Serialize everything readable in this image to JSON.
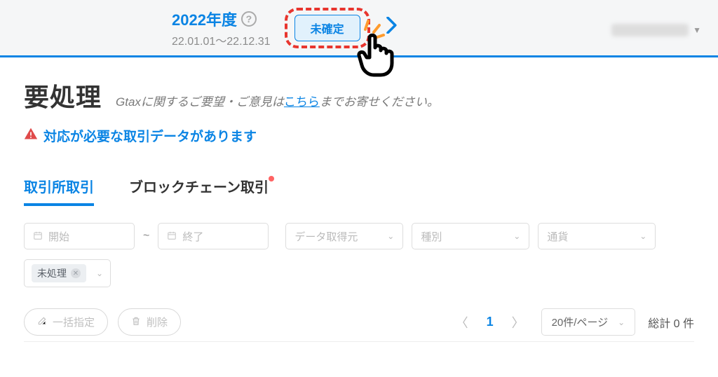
{
  "header": {
    "year_title": "2022年度",
    "date_range": "22.01.01～22.12.31",
    "status_btn": "未確定"
  },
  "page": {
    "title": "要処理",
    "subtitle_prefix": "Gtaxに関するご要望・ご意見は",
    "subtitle_link": "こちら",
    "subtitle_suffix": "までお寄せください。",
    "warning": "対応が必要な取引データがあります"
  },
  "tabs": [
    {
      "label": "取引所取引",
      "active": true,
      "dot": false
    },
    {
      "label": "ブロックチェーン取引",
      "active": false,
      "dot": true
    }
  ],
  "filters": {
    "start_placeholder": "開始",
    "end_placeholder": "終了",
    "source_placeholder": "データ取得元",
    "type_placeholder": "種別",
    "currency_placeholder": "通貨",
    "status_tag": "未処理"
  },
  "toolbar": {
    "batch_label": "一括指定",
    "delete_label": "削除"
  },
  "pager": {
    "current": "1",
    "per_page": "20件/ページ",
    "total": "総計 0 件"
  }
}
